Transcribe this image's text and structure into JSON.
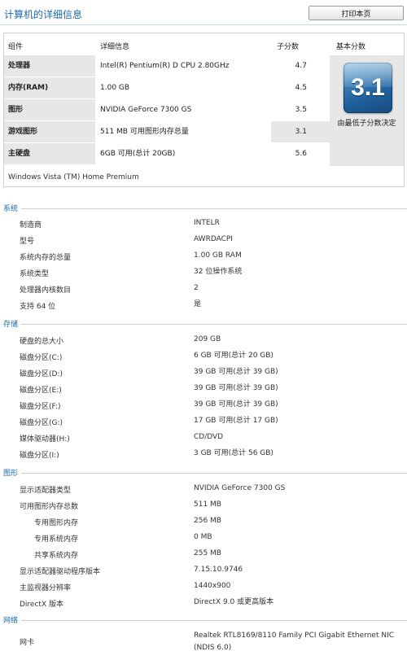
{
  "header": {
    "title": "计算机的详细信息",
    "print_label": "打印本页"
  },
  "table": {
    "col_component": "组件",
    "col_detail": "详细信息",
    "col_subscore": "子分数",
    "col_basescore": "基本分数",
    "rows": [
      {
        "component": "处理器",
        "detail": "Intel(R) Pentium(R) D CPU 2.80GHz",
        "score": "4.7"
      },
      {
        "component": "内存(RAM)",
        "detail": "1.00 GB",
        "score": "4.5"
      },
      {
        "component": "图形",
        "detail": "NVIDIA GeForce 7300 GS",
        "score": "3.5"
      },
      {
        "component": "游戏图形",
        "detail": "511 MB 可用图形内存总量",
        "score": "3.1"
      },
      {
        "component": "主硬盘",
        "detail": "6GB 可用(总计 20GB)",
        "score": "5.6"
      }
    ],
    "base_score": "3.1",
    "base_caption": "由最低子分数决定",
    "os": "Windows Vista (TM) Home Premium"
  },
  "system": {
    "title": "系统",
    "rows": [
      {
        "label": "制造商",
        "value": "INTELR"
      },
      {
        "label": "型号",
        "value": "AWRDACPI"
      },
      {
        "label": "系统内存的总量",
        "value": "1.00 GB RAM"
      },
      {
        "label": "系统类型",
        "value": "32 位操作系统"
      },
      {
        "label": "处理器内核数目",
        "value": "2"
      },
      {
        "label": "支持 64 位",
        "value": "是"
      }
    ]
  },
  "storage": {
    "title": "存储",
    "rows": [
      {
        "label": "硬盘的总大小",
        "value": "209 GB"
      },
      {
        "label": "磁盘分区(C:)",
        "value": "6 GB 可用(总计 20 GB)"
      },
      {
        "label": "磁盘分区(D:)",
        "value": "39 GB 可用(总计 39 GB)"
      },
      {
        "label": "磁盘分区(E:)",
        "value": "39 GB 可用(总计 39 GB)"
      },
      {
        "label": "磁盘分区(F:)",
        "value": "39 GB 可用(总计 39 GB)"
      },
      {
        "label": "磁盘分区(G:)",
        "value": "17 GB 可用(总计 17 GB)"
      },
      {
        "label": "媒体驱动器(H:)",
        "value": "CD/DVD"
      },
      {
        "label": "磁盘分区(I:)",
        "value": "3 GB 可用(总计 56 GB)"
      }
    ]
  },
  "graphics": {
    "title": "图形",
    "rows": [
      {
        "label": "显示适配器类型",
        "value": "NVIDIA GeForce 7300 GS"
      },
      {
        "label": "可用图形内存总数",
        "value": "511 MB"
      },
      {
        "label": "专用图形内存",
        "value": "256 MB"
      },
      {
        "label": "专用系统内存",
        "value": "0 MB"
      },
      {
        "label": "共享系统内存",
        "value": "255 MB"
      },
      {
        "label": "显示适配器驱动程序版本",
        "value": "7.15.10.9746"
      },
      {
        "label": "主监视器分辨率",
        "value": "1440x900"
      },
      {
        "label": "DirectX 版本",
        "value": "DirectX 9.0 或更高版本"
      }
    ]
  },
  "network": {
    "title": "网络",
    "rows": [
      {
        "label": "网卡",
        "value_line1": "Realtek RTL8169/8110 Family PCI Gigabit Ethernet NIC",
        "value_line2": "(NDIS 6.0)"
      }
    ]
  }
}
